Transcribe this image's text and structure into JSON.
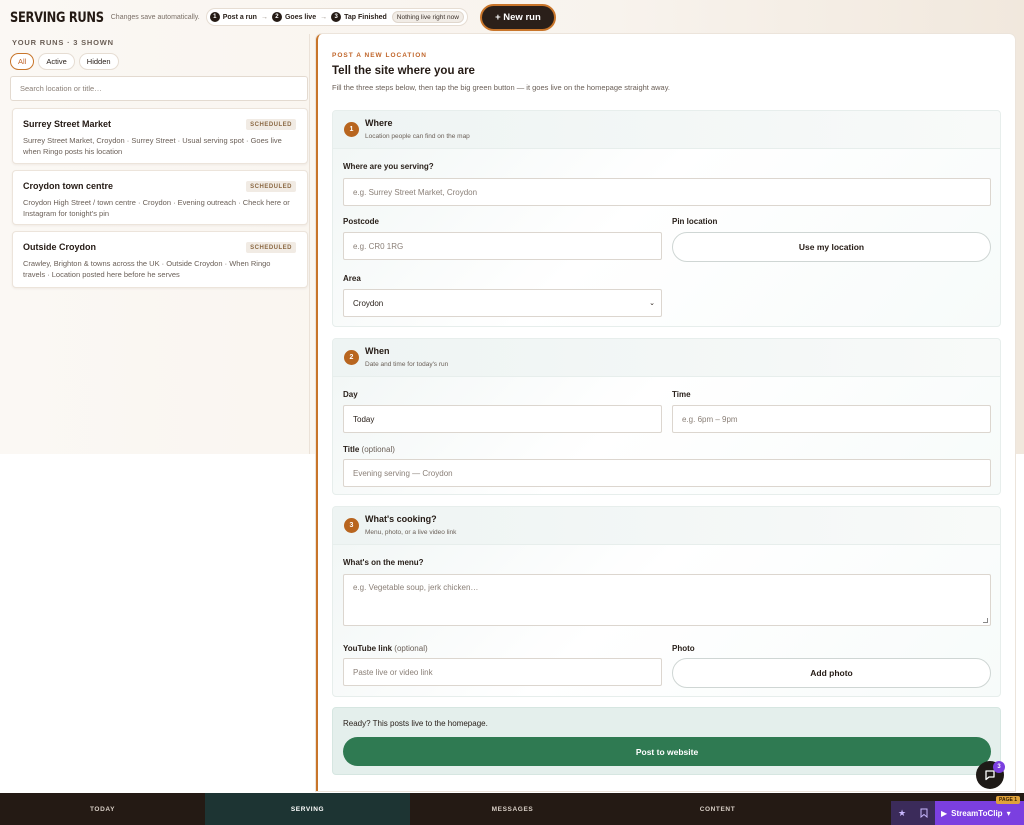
{
  "app": {
    "brand": "SERVING RUNS",
    "autosave_note": "Changes save automatically.",
    "steps": [
      {
        "num": "1",
        "label": "Post a run"
      },
      {
        "num": "2",
        "label": "Goes live"
      },
      {
        "num": "3",
        "label": "Tap Finished"
      }
    ],
    "live_status": "Nothing live right now",
    "new_run_label": "+ New run"
  },
  "runs_panel": {
    "title": "YOUR RUNS · 3 SHOWN",
    "filters": [
      "All",
      "Active",
      "Hidden"
    ],
    "search_placeholder": "Search location or title…",
    "runs": [
      {
        "title": "Surrey Street Market",
        "status": "SCHEDULED",
        "description": "Surrey Street Market, Croydon · Surrey Street · Usual serving spot · Goes live when Ringo posts his location"
      },
      {
        "title": "Croydon town centre",
        "status": "SCHEDULED",
        "description": "Croydon High Street / town centre · Croydon · Evening outreach · Check here or Instagram for tonight's pin"
      },
      {
        "title": "Outside Croydon",
        "status": "SCHEDULED",
        "description": "Crawley, Brighton & towns across the UK · Outside Croydon · When Ringo travels · Location posted here before he serves"
      }
    ]
  },
  "form": {
    "kicker": "POST A NEW LOCATION",
    "title": "Tell the site where you are",
    "subtitle": "Fill the three steps below, then tap the big green button — it goes live on the homepage straight away.",
    "where": {
      "num": "1",
      "title": "Where",
      "subtitle": "Location people can find on the map",
      "serving_label": "Where are you serving?",
      "serving_placeholder": "e.g. Surrey Street Market, Croydon",
      "postcode_label": "Postcode",
      "postcode_placeholder": "e.g. CR0 1RG",
      "pin_label": "Pin location",
      "pin_button": "Use my location",
      "area_label": "Area",
      "area_value": "Croydon"
    },
    "when": {
      "num": "2",
      "title": "When",
      "subtitle": "Date and time for today's run",
      "day_label": "Day",
      "day_value": "Today",
      "time_label": "Time",
      "time_placeholder": "e.g. 6pm – 9pm",
      "title_label": "Title",
      "title_optional": "(optional)",
      "title_placeholder": "Evening serving — Croydon"
    },
    "cooking": {
      "num": "3",
      "title": "What's cooking?",
      "subtitle": "Menu, photo, or a live video link",
      "menu_label": "What's on the menu?",
      "menu_placeholder": "e.g. Vegetable soup, jerk chicken…",
      "youtube_label": "YouTube link",
      "youtube_optional": "(optional)",
      "youtube_placeholder": "Paste live or video link",
      "photo_label": "Photo",
      "photo_button": "Add photo"
    },
    "submit": {
      "ready_text": "Ready? This posts live to the homepage.",
      "button": "Post to website"
    }
  },
  "chat": {
    "badge_count": "3"
  },
  "bottom_nav": {
    "items": [
      "TODAY",
      "SERVING",
      "MESSAGES",
      "CONTENT"
    ],
    "active": "SERVING"
  },
  "extension": {
    "name": "StreamToClip",
    "tag": "PAGE 1"
  }
}
